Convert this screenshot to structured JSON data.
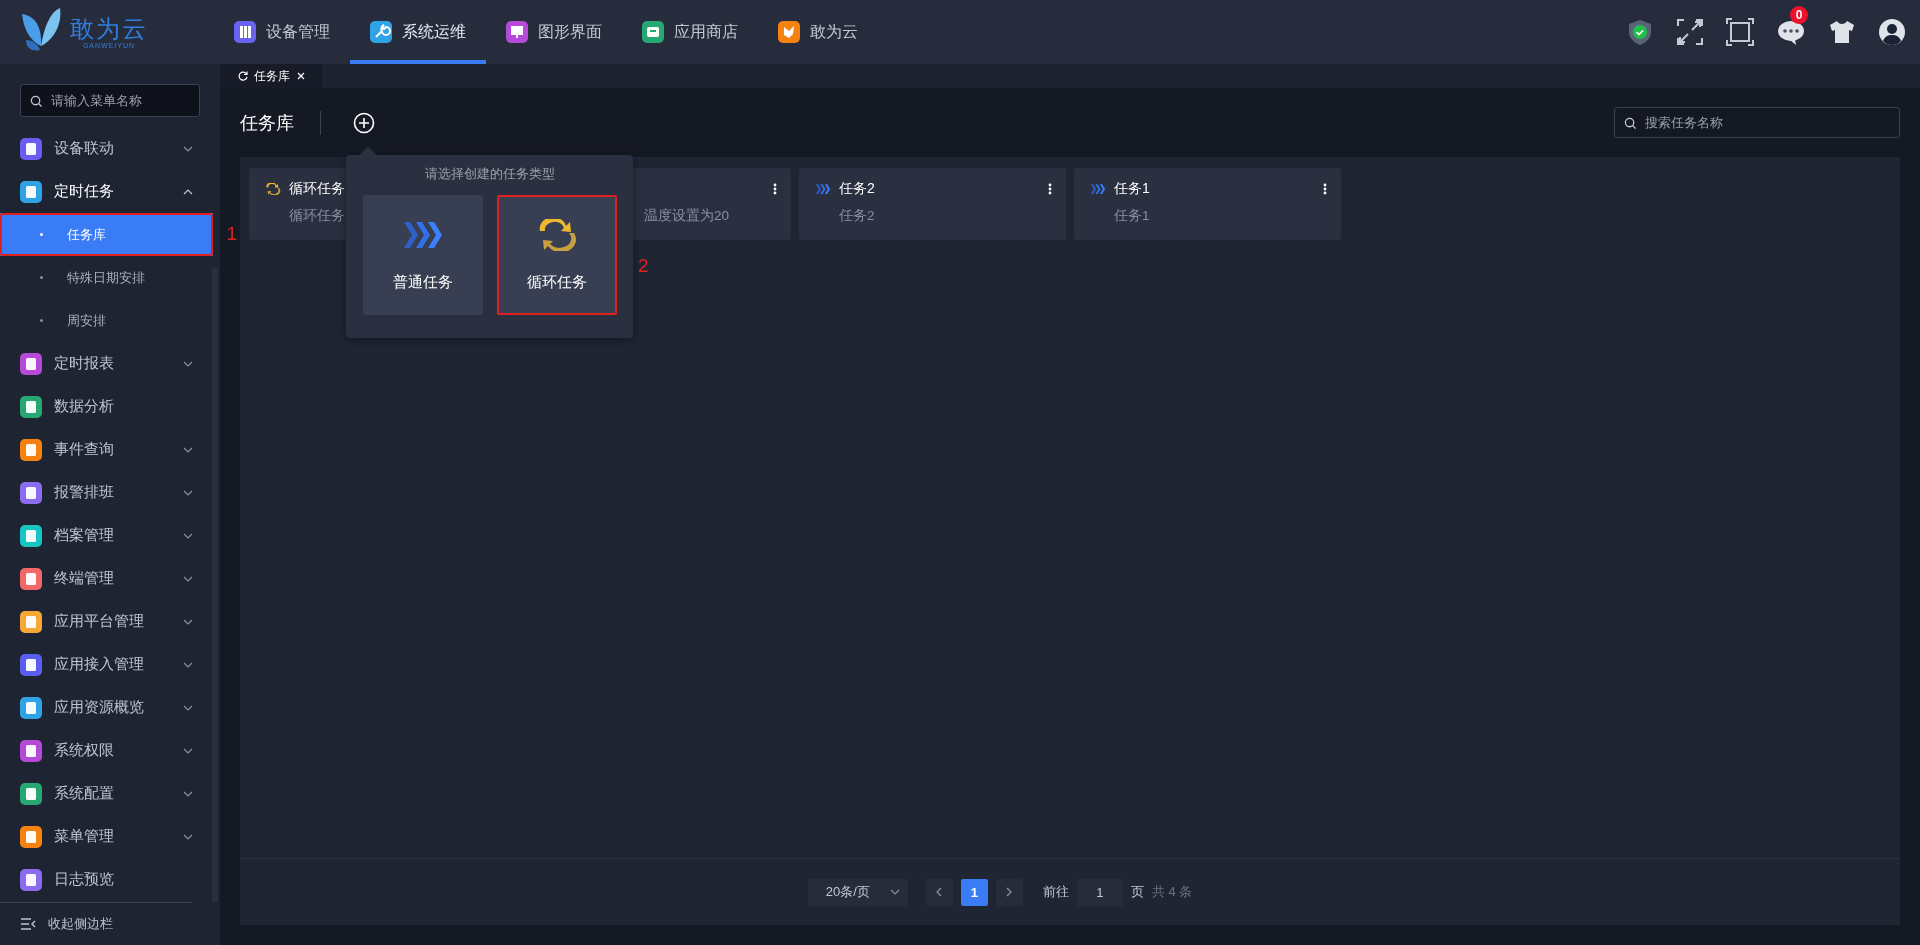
{
  "header": {
    "logo_text": "敢为云",
    "logo_subtext": "GANWEIYUN",
    "nav": [
      {
        "label": "设备管理",
        "color": "#6b63f0",
        "selected": false
      },
      {
        "label": "系统运维",
        "color": "#2ea3e6",
        "selected": true
      },
      {
        "label": "图形界面",
        "color": "#b64ad8",
        "selected": false
      },
      {
        "label": "应用商店",
        "color": "#27a872",
        "selected": false
      },
      {
        "label": "敢为云",
        "color": "#f5820f",
        "selected": false
      }
    ],
    "message_badge": "0"
  },
  "sidebar": {
    "search": {
      "placeholder": "请输入菜单名称"
    },
    "items": [
      {
        "label": "设备联动",
        "color": "#6b5cf0",
        "kind": "group",
        "expanded": false
      },
      {
        "label": "定时任务",
        "color": "#2ea3e6",
        "kind": "group",
        "expanded": true,
        "children": [
          {
            "label": "任务库",
            "selected": true,
            "callout": "1"
          },
          {
            "label": "特殊日期安排",
            "selected": false
          },
          {
            "label": "周安排",
            "selected": false
          }
        ]
      },
      {
        "label": "定时报表",
        "color": "#b64ad8",
        "kind": "group",
        "expanded": false
      },
      {
        "label": "数据分析",
        "color": "#27a872",
        "kind": "link"
      },
      {
        "label": "事件查询",
        "color": "#f5820f",
        "kind": "group",
        "expanded": false
      },
      {
        "label": "报警排班",
        "color": "#8b6cf0",
        "kind": "group",
        "expanded": false
      },
      {
        "label": "档案管理",
        "color": "#17c6c0",
        "kind": "group",
        "expanded": false
      },
      {
        "label": "终端管理",
        "color": "#f06868",
        "kind": "group",
        "expanded": false
      },
      {
        "label": "应用平台管理",
        "color": "#f5a934",
        "kind": "group",
        "expanded": false
      },
      {
        "label": "应用接入管理",
        "color": "#5a5ef0",
        "kind": "group",
        "expanded": false
      },
      {
        "label": "应用资源概览",
        "color": "#2ea3e6",
        "kind": "group",
        "expanded": false
      },
      {
        "label": "系统权限",
        "color": "#b64ad8",
        "kind": "group",
        "expanded": false
      },
      {
        "label": "系统配置",
        "color": "#27a872",
        "kind": "group",
        "expanded": false
      },
      {
        "label": "菜单管理",
        "color": "#f5820f",
        "kind": "group",
        "expanded": false
      },
      {
        "label": "日志预览",
        "color": "#8b6cf0",
        "kind": "link"
      }
    ],
    "collapse_label": "收起侧边栏"
  },
  "tabs": [
    {
      "label": "任务库",
      "selected": true
    }
  ],
  "page": {
    "title": "任务库",
    "search": {
      "placeholder": "搜索任务名称"
    },
    "cards": [
      {
        "kind": "loop",
        "title": "循环任务",
        "description": "循环任务"
      },
      {
        "kind": "partial",
        "description": "温度设置为20"
      },
      {
        "kind": "normal",
        "title": "任务2",
        "description": "任务2"
      },
      {
        "kind": "normal",
        "title": "任务1",
        "description": "任务1"
      }
    ],
    "popup": {
      "title": "请选择创建的任务类型",
      "options": [
        {
          "kind": "normal",
          "label": "普通任务"
        },
        {
          "kind": "loop",
          "label": "循环任务",
          "callout": "2"
        }
      ]
    },
    "pagination": {
      "page_size": "20条/页",
      "pages": [
        {
          "label": "1",
          "selected": true
        }
      ],
      "goto_label": "前往",
      "goto_value": "1",
      "page_unit": "页",
      "total": "共 4 条"
    }
  }
}
